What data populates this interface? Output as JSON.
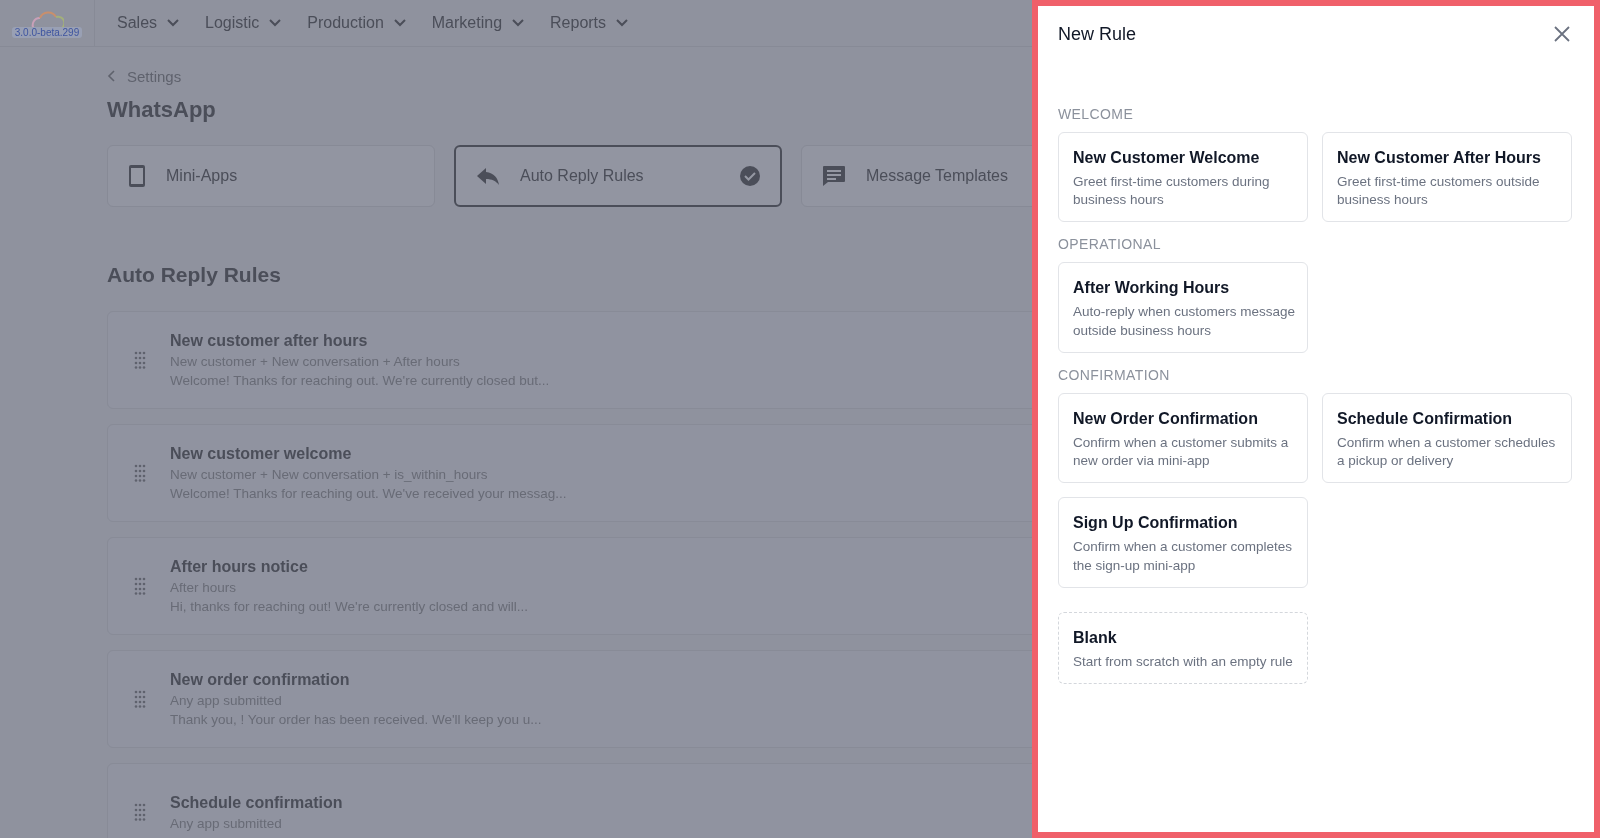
{
  "version_badge": "3.0.0-beta.299",
  "nav": [
    {
      "label": "Sales"
    },
    {
      "label": "Logistic"
    },
    {
      "label": "Production"
    },
    {
      "label": "Marketing"
    },
    {
      "label": "Reports"
    }
  ],
  "breadcrumb": "Settings",
  "page_title": "WhatsApp",
  "tabs": [
    {
      "label": "Mini-Apps",
      "kind": "phone",
      "selected": false
    },
    {
      "label": "Auto Reply Rules",
      "kind": "reply",
      "selected": true
    },
    {
      "label": "Message Templates",
      "kind": "message",
      "selected": false
    }
  ],
  "section_title": "Auto Reply Rules",
  "rules": [
    {
      "title": "New customer after hours",
      "conditions": "New customer + New conversation + After hours",
      "preview": "Welcome! Thanks for reaching out. We're currently closed but..."
    },
    {
      "title": "New customer welcome",
      "conditions": "New customer + New conversation + is_within_hours",
      "preview": "Welcome! Thanks for reaching out. We've received your messag..."
    },
    {
      "title": "After hours notice",
      "conditions": "After hours",
      "preview": "Hi, thanks for reaching out! We're currently closed and will..."
    },
    {
      "title": "New order confirmation",
      "conditions": "Any app submitted",
      "preview": "Thank you, ! Your order has been received. We'll keep you u..."
    },
    {
      "title": "Schedule confirmation",
      "conditions": "Any app submitted"
    }
  ],
  "drawer": {
    "title": "New Rule",
    "groups": [
      {
        "label": "WELCOME",
        "templates": [
          {
            "kind": "template",
            "title": "New Customer Welcome",
            "description": "Greet first-time customers during business hours"
          },
          {
            "kind": "template",
            "title": "New Customer After Hours",
            "description": "Greet first-time customers outside business hours"
          }
        ]
      },
      {
        "label": "OPERATIONAL",
        "templates": [
          {
            "kind": "template",
            "title": "After Working Hours",
            "description": "Auto-reply when customers message outside business hours"
          }
        ]
      },
      {
        "label": "CONFIRMATION",
        "templates": [
          {
            "kind": "template",
            "title": "New Order Confirmation",
            "description": "Confirm when a customer submits a new order via mini-app"
          },
          {
            "kind": "template",
            "title": "Schedule Confirmation",
            "description": "Confirm when a customer schedules a pickup or delivery"
          },
          {
            "kind": "template",
            "title": "Sign Up Confirmation",
            "description": "Confirm when a customer completes the sign-up mini-app"
          }
        ]
      },
      {
        "templates": [
          {
            "kind": "blank",
            "title": "Blank",
            "description": "Start from scratch with an empty rule"
          }
        ]
      }
    ]
  }
}
